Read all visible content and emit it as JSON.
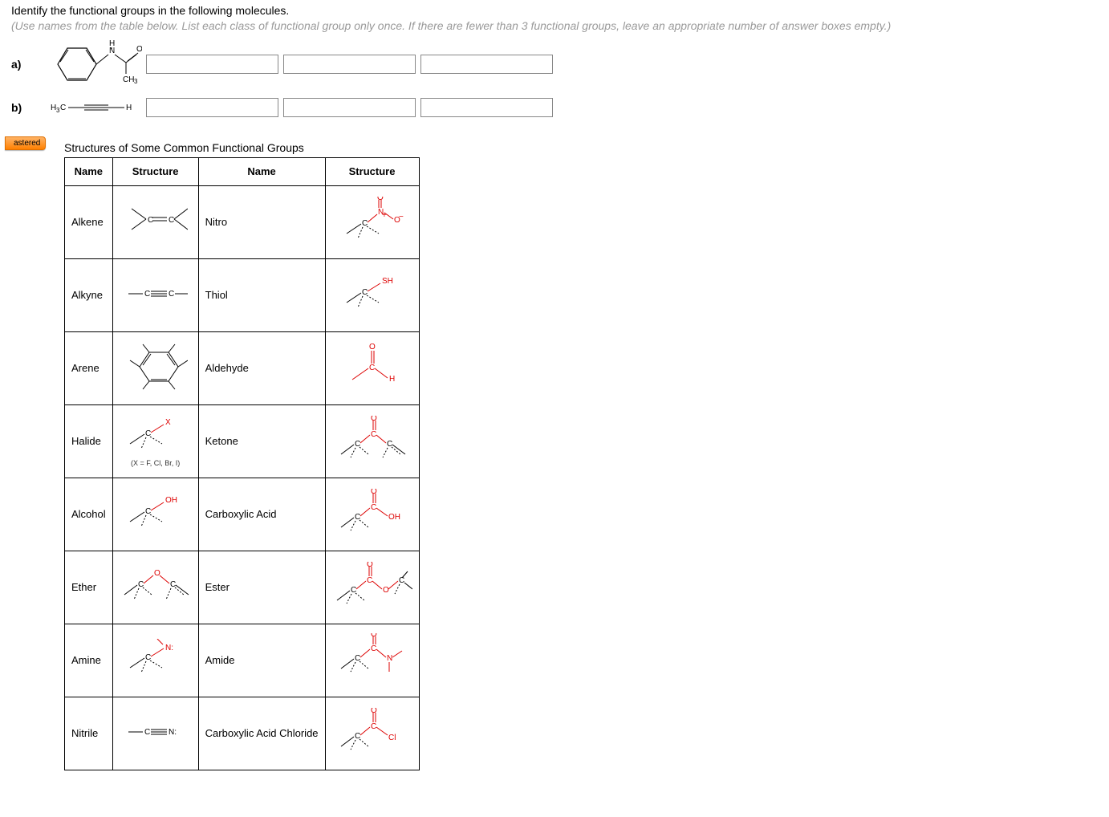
{
  "question": {
    "title": "Identify the functional groups in the following molecules.",
    "hint": "(Use names from the table below. List each class of functional group only once. If there are fewer than 3 functional groups, leave an appropriate number of answer boxes empty.)"
  },
  "parts": [
    {
      "label": "a)",
      "molecule": "phenyl-N(H)-acetyl",
      "answers": [
        "",
        "",
        ""
      ]
    },
    {
      "label": "b)",
      "molecule": "propyne-H3C-CC-H",
      "answers": [
        "",
        "",
        ""
      ]
    }
  ],
  "tab": "astered",
  "table": {
    "title": "Structures of Some Common Functional Groups",
    "headers": [
      "Name",
      "Structure",
      "Name",
      "Structure"
    ],
    "rows": [
      {
        "n1": "Alkene",
        "s1": "C=C",
        "n2": "Nitro",
        "s2": "C-NO2"
      },
      {
        "n1": "Alkyne",
        "s1": "—C≡C—",
        "n2": "Thiol",
        "s2": "C-SH"
      },
      {
        "n1": "Arene",
        "s1": "benzene",
        "n2": "Aldehyde",
        "s2": "C(=O)H"
      },
      {
        "n1": "Halide",
        "s1": "C-X",
        "note1": "(X = F, Cl, Br, I)",
        "n2": "Ketone",
        "s2": "C-C(=O)-C"
      },
      {
        "n1": "Alcohol",
        "s1": "C-OH",
        "n2": "Carboxylic Acid",
        "s2": "C(=O)OH"
      },
      {
        "n1": "Ether",
        "s1": "C-O-C",
        "n2": "Ester",
        "s2": "C(=O)O-C"
      },
      {
        "n1": "Amine",
        "s1": "C-N:",
        "n2": "Amide",
        "s2": "C(=O)N"
      },
      {
        "n1": "Nitrile",
        "s1": "—C≡N:",
        "n2": "Carboxylic Acid Chloride",
        "s2": "C(=O)Cl"
      }
    ]
  }
}
